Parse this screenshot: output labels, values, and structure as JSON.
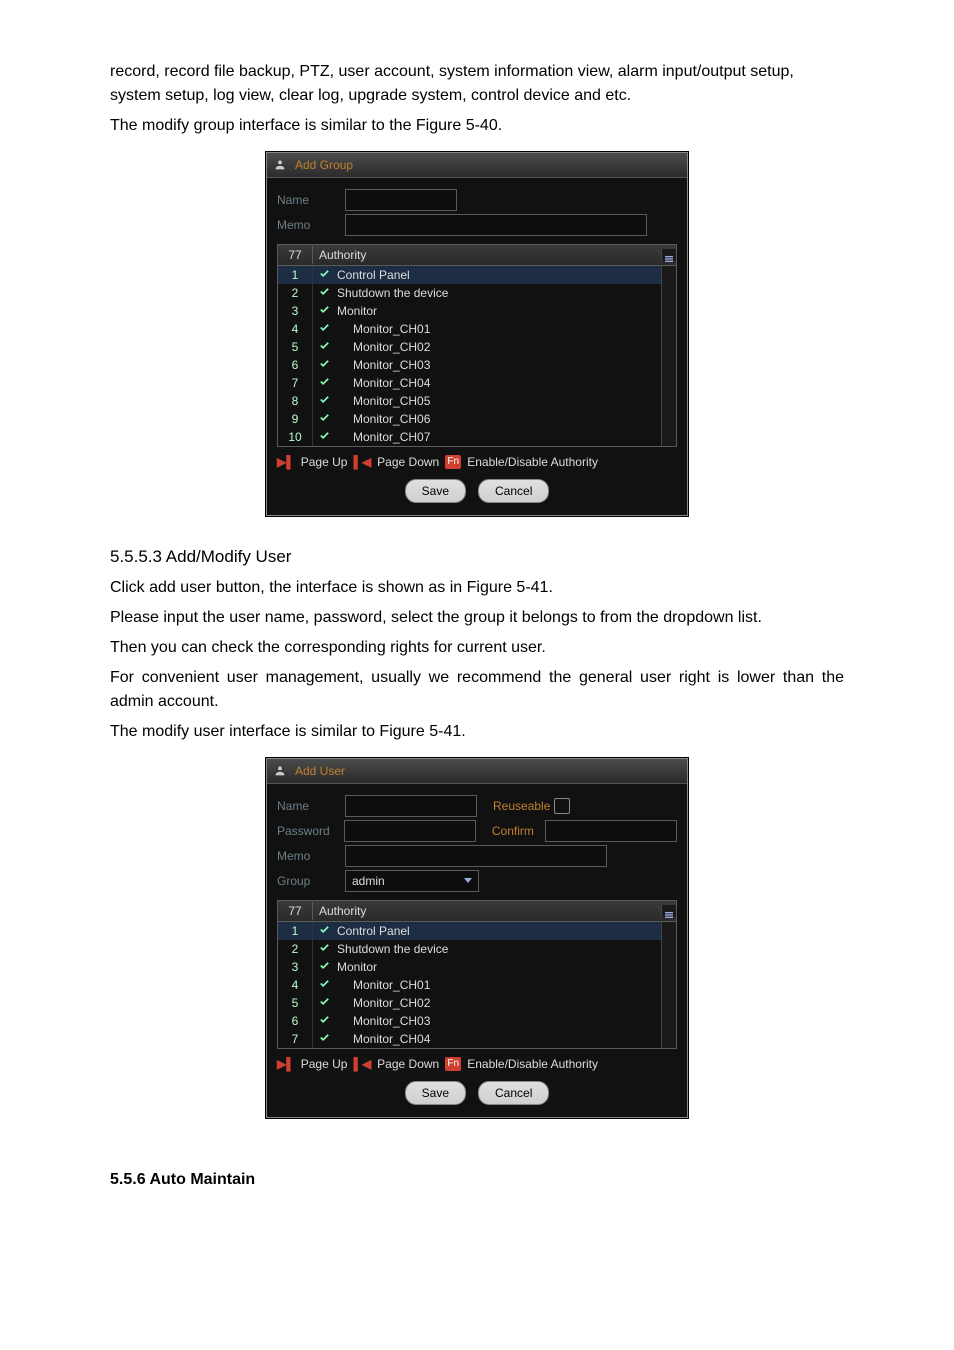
{
  "intro": {
    "p1": "record, record file backup, PTZ, user account, system information view, alarm input/output setup, system setup, log view, clear log, upgrade system, control device and etc.",
    "p2": "The modify group interface is similar to the Figure 5-40."
  },
  "add_group": {
    "title": "Add Group",
    "name_label": "Name",
    "memo_label": "Memo",
    "header": {
      "count_label": "77",
      "auth_label": "Authority"
    },
    "rows": [
      {
        "n": "1",
        "label": "Control Panel",
        "indent": false,
        "sel": true
      },
      {
        "n": "2",
        "label": "Shutdown the device",
        "indent": false,
        "sel": false
      },
      {
        "n": "3",
        "label": "Monitor",
        "indent": false,
        "sel": false
      },
      {
        "n": "4",
        "label": "Monitor_CH01",
        "indent": true,
        "sel": false
      },
      {
        "n": "5",
        "label": "Monitor_CH02",
        "indent": true,
        "sel": false
      },
      {
        "n": "6",
        "label": "Monitor_CH03",
        "indent": true,
        "sel": false
      },
      {
        "n": "7",
        "label": "Monitor_CH04",
        "indent": true,
        "sel": false
      },
      {
        "n": "8",
        "label": "Monitor_CH05",
        "indent": true,
        "sel": false
      },
      {
        "n": "9",
        "label": "Monitor_CH06",
        "indent": true,
        "sel": false
      },
      {
        "n": "10",
        "label": "Monitor_CH07",
        "indent": true,
        "sel": false
      }
    ],
    "pager": {
      "pageup": "Page Up",
      "pagedown": "Page Down",
      "fn": "Fn",
      "enable": "Enable/Disable Authority"
    },
    "save_label": "Save",
    "cancel_label": "Cancel"
  },
  "section": {
    "heading": "5.5.5.3  Add/Modify User",
    "p1": "Click add user button, the interface is shown as in Figure 5-41.",
    "p2": "Please input the user name, password, select the group it belongs to from the dropdown list.",
    "p3": "Then you can check the corresponding rights for current user.",
    "p4": "For convenient user management, usually we recommend the general user right is lower than the admin account.",
    "p5": "The modify user interface is similar to Figure 5-41."
  },
  "add_user": {
    "title": "Add User",
    "name_label": "Name",
    "reuse_label": "Reuseable",
    "pass_label": "Password",
    "confirm_label": "Confirm",
    "memo_label": "Memo",
    "group_label": "Group",
    "group_value": "admin",
    "header": {
      "count_label": "77",
      "auth_label": "Authority"
    },
    "rows": [
      {
        "n": "1",
        "label": "Control Panel",
        "indent": false,
        "sel": true
      },
      {
        "n": "2",
        "label": "Shutdown the device",
        "indent": false,
        "sel": false
      },
      {
        "n": "3",
        "label": "Monitor",
        "indent": false,
        "sel": false
      },
      {
        "n": "4",
        "label": "Monitor_CH01",
        "indent": true,
        "sel": false
      },
      {
        "n": "5",
        "label": "Monitor_CH02",
        "indent": true,
        "sel": false
      },
      {
        "n": "6",
        "label": "Monitor_CH03",
        "indent": true,
        "sel": false
      },
      {
        "n": "7",
        "label": "Monitor_CH04",
        "indent": true,
        "sel": false
      }
    ],
    "pager": {
      "pageup": "Page Up",
      "pagedown": "Page Down",
      "fn": "Fn",
      "enable": "Enable/Disable Authority"
    },
    "save_label": "Save",
    "cancel_label": "Cancel"
  },
  "footer": {
    "heading": "5.5.6  Auto Maintain"
  }
}
